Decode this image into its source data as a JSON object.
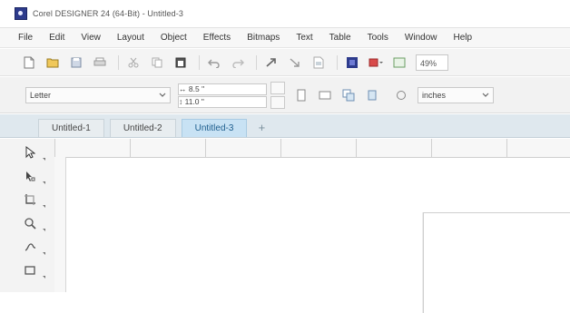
{
  "window": {
    "title": "Corel DESIGNER 24 (64-Bit) - Untitled-3",
    "app_icon": "corel-designer-logo-icon"
  },
  "menu": {
    "items": [
      "File",
      "Edit",
      "View",
      "Layout",
      "Object",
      "Effects",
      "Bitmaps",
      "Text",
      "Table",
      "Tools",
      "Window",
      "Help"
    ]
  },
  "standard_toolbar": {
    "icons": [
      "new-document-icon",
      "open-icon",
      "save-icon",
      "print-icon",
      "cut-icon",
      "copy-icon",
      "paste-icon",
      "undo-icon",
      "redo-icon",
      "import-icon",
      "export-icon",
      "publish-pdf-icon",
      "app-launcher-icon",
      "zoom-level-icon"
    ],
    "zoom_value": "49%"
  },
  "property_bar": {
    "page_size": "Letter",
    "width_value": "8.5",
    "height_value": "11.0",
    "units_label": "inches"
  },
  "document_tabs": {
    "tabs": [
      "Untitled-1",
      "Untitled-2",
      "Untitled-3"
    ],
    "active_index": 2,
    "add_symbol": "+"
  },
  "toolbox": {
    "tools": [
      "pick-tool-icon",
      "shape-tool-icon",
      "crop-tool-icon",
      "zoom-tool-icon",
      "freehand-tool-icon",
      "rectangle-tool-icon"
    ]
  },
  "colors": {
    "accent": "#1e5e8e",
    "active_tab_bg": "#c8e2f4",
    "tab_strip_bg": "#dfe8ee"
  }
}
